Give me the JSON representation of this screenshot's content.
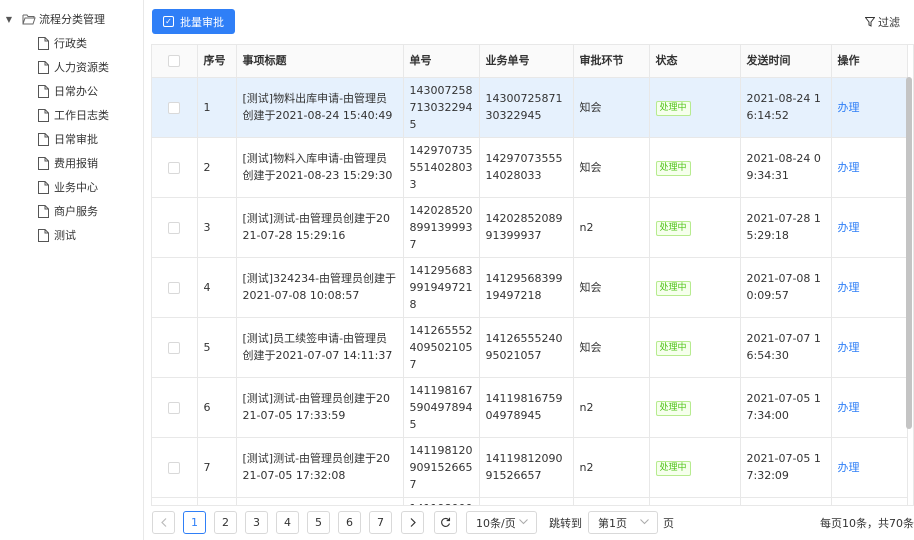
{
  "sidebar": {
    "root_label": "流程分类管理",
    "items": [
      {
        "label": "行政类"
      },
      {
        "label": "人力资源类"
      },
      {
        "label": "日常办公"
      },
      {
        "label": "工作日志类"
      },
      {
        "label": "日常审批"
      },
      {
        "label": "费用报销"
      },
      {
        "label": "业务中心"
      },
      {
        "label": "商户服务"
      },
      {
        "label": "测试"
      }
    ]
  },
  "toolbar": {
    "batch_label": "批量审批",
    "filter_label": "过滤"
  },
  "table": {
    "headers": {
      "index": "序号",
      "title": "事项标题",
      "order_no": "单号",
      "business_no": "业务单号",
      "step": "审批环节",
      "status": "状态",
      "sent_time": "发送时间",
      "action": "操作"
    },
    "rows": [
      {
        "index": "1",
        "title": "[测试]物料出库申请-由管理员创建于2021-08-24 15:40:49",
        "order_no": "1430072587130322945",
        "business_no": "1430072587130322945",
        "step": "知会",
        "status": "处理中",
        "sent_time": "2021-08-24 16:14:52",
        "action": "办理",
        "selected": true
      },
      {
        "index": "2",
        "title": "[测试]物料入库申请-由管理员创建于2021-08-23 15:29:30",
        "order_no": "1429707355514028033",
        "business_no": "1429707355514028033",
        "step": "知会",
        "status": "处理中",
        "sent_time": "2021-08-24 09:34:31",
        "action": "办理"
      },
      {
        "index": "3",
        "title": "[测试]测试-由管理员创建于2021-07-28 15:29:16",
        "order_no": "1420285208991399937",
        "business_no": "1420285208991399937",
        "step": "n2",
        "status": "处理中",
        "sent_time": "2021-07-28 15:29:18",
        "action": "办理"
      },
      {
        "index": "4",
        "title": "[测试]324234-由管理员创建于2021-07-08 10:08:57",
        "order_no": "1412956839919497218",
        "business_no": "1412956839919497218",
        "step": "知会",
        "status": "处理中",
        "sent_time": "2021-07-08 10:09:57",
        "action": "办理"
      },
      {
        "index": "5",
        "title": "[测试]员工续签申请-由管理员创建于2021-07-07 14:11:37",
        "order_no": "1412655524095021057",
        "business_no": "1412655524095021057",
        "step": "知会",
        "status": "处理中",
        "sent_time": "2021-07-07 16:54:30",
        "action": "办理"
      },
      {
        "index": "6",
        "title": "[测试]测试-由管理员创建于2021-07-05 17:33:59",
        "order_no": "1411981675904978945",
        "business_no": "1411981675904978945",
        "step": "n2",
        "status": "处理中",
        "sent_time": "2021-07-05 17:34:00",
        "action": "办理"
      },
      {
        "index": "7",
        "title": "[测试]测试-由管理员创建于2021-07-05 17:32:08",
        "order_no": "1411981209091526657",
        "business_no": "1411981209091526657",
        "step": "n2",
        "status": "处理中",
        "sent_time": "2021-07-05 17:32:09",
        "action": "办理"
      }
    ],
    "partial_row": {
      "order_no": "141198000"
    }
  },
  "pagination": {
    "pages": [
      "1",
      "2",
      "3",
      "4",
      "5",
      "6",
      "7"
    ],
    "current_page": "1",
    "page_size": "10条/页",
    "jump_label": "跳转到",
    "jump_value": "第1页",
    "page_suffix": "页",
    "total": "每页10条，共70条"
  },
  "colors": {
    "primary": "#2f7ff7",
    "selected_row": "#e6f1fd",
    "status_green": "#52c41a"
  }
}
